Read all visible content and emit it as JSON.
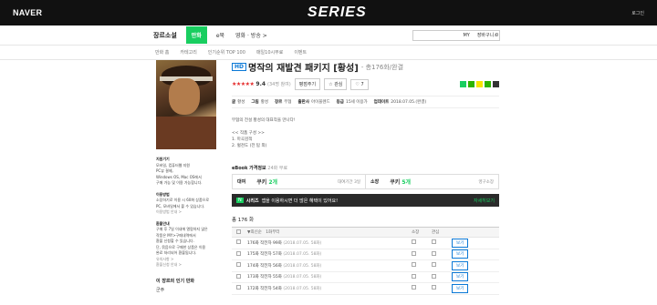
{
  "topbar": {
    "naver": "NAVER",
    "series": "SERIES",
    "login": "로그인"
  },
  "nav1": {
    "logo": "장르소설",
    "tabs": [
      "만화",
      "e북",
      "영화 · 방송 >"
    ],
    "active_tab": "만화",
    "right": [
      "MY",
      "장바구니 0"
    ]
  },
  "nav2": [
    "만화 홈",
    "카테고리",
    "인기순위 TOP 100",
    "매일10시무료",
    "이벤트"
  ],
  "book": {
    "hd": "HD",
    "title": "명작의 재발견 패키지 [황성]",
    "episodes": "- 총176화/완결",
    "stars": "★★★★★",
    "rating": "9.4",
    "rating_count": "(34명 참여)",
    "rate_btn": "평점주기",
    "fav_btn": "관심",
    "like_btn": "♡ 7",
    "meta": [
      {
        "k": "글",
        "v": "황성"
      },
      {
        "k": "그림",
        "v": "황성"
      },
      {
        "k": "장르",
        "v": "무협"
      },
      {
        "k": "출판사",
        "v": "아이블렌드"
      },
      {
        "k": "등급",
        "v": "15세 이용가"
      },
      {
        "k": "업데이트",
        "v": "2018.07.05.(완결)"
      }
    ],
    "desc": [
      "무협의 전설 황성의 대표작을 만나다!",
      "",
      "<< 작품 구성 >>",
      "1. 마곡검객",
      "2. 혈천도 (전 탐 외)"
    ]
  },
  "left": {
    "info": [
      {
        "h": "지원기기"
      },
      {
        "t": "모바일, 컴퓨터웹 지원"
      },
      {
        "t": "PC뷰 결제,"
      },
      {
        "t": "Windows OS, Mac OS에서"
      },
      {
        "t": "구매 가능 및 이용 가능합니다."
      },
      {
        "h": "이용방법"
      },
      {
        "t": "소장하기로 이용 시 60화 상품으로"
      },
      {
        "t": "PC, 모바일에서 볼 수 있습니다."
      },
      {
        "l": "이용방법 안내 >"
      },
      {
        "h": "환불안내"
      },
      {
        "t": "구매 후 7일 이내에 열람하지 않은"
      },
      {
        "t": "작품은 MY>구매내역에서"
      },
      {
        "t": "환불 신청할 수 있습니다."
      },
      {
        "t": "단, 묶음으로 구매한 상품은 이용"
      },
      {
        "t": "완료 처리되어 환불됩니다."
      },
      {
        "l": "유의사항 >"
      },
      {
        "l": "환불신청 안내 >"
      }
    ],
    "genre_title": "이 장르의 인기 만화",
    "genre_first": "군주"
  },
  "buy": {
    "header": "eBook 가격정보",
    "header_sub": "24화 무료",
    "rent": {
      "k": "대여",
      "label": "쿠키",
      "count": "2개",
      "note": "대여기간 3일"
    },
    "own": {
      "k": "소장",
      "label": "쿠키",
      "count": "5개",
      "note": "영구소장"
    }
  },
  "banner": {
    "icon": "N",
    "label": "시리즈",
    "text": "앱을 이용하시면 더 많은 혜택이 있어요!",
    "more": "자세히보기"
  },
  "list": {
    "total": "총 176 화",
    "header": [
      "",
      "▼최신순",
      "1화부터",
      "소장",
      "관심",
      ""
    ],
    "rows": [
      {
        "title": "176화 작전자 99화",
        "date": "(2018.07.05. 58화)",
        "btn": "보기"
      },
      {
        "title": "175화 작전자 57화",
        "date": "(2018.07.05. 58화)",
        "btn": "보기"
      },
      {
        "title": "174화 작전자 56화",
        "date": "(2018.07.05. 58화)",
        "btn": "보기"
      },
      {
        "title": "173화 작전자 55화",
        "date": "(2018.07.05. 58화)",
        "btn": "보기"
      },
      {
        "title": "172화 작전자 54화",
        "date": "(2018.07.05. 58화)",
        "btn": "보기"
      }
    ]
  }
}
